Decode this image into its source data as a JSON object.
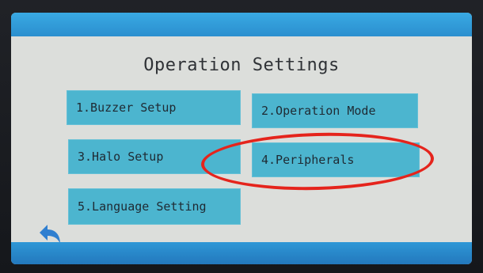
{
  "screen": {
    "title": "Operation Settings",
    "menu": [
      {
        "label": "1.Buzzer Setup"
      },
      {
        "label": "2.Operation Mode"
      },
      {
        "label": "3.Halo Setup"
      },
      {
        "label": "4.Peripherals"
      },
      {
        "label": "5.Language Setting"
      }
    ],
    "back_icon": "back-arrow-icon",
    "accent_color": "#2b8fcf",
    "button_color": "#4cb5cf",
    "highlight_color": "#e5241c"
  }
}
